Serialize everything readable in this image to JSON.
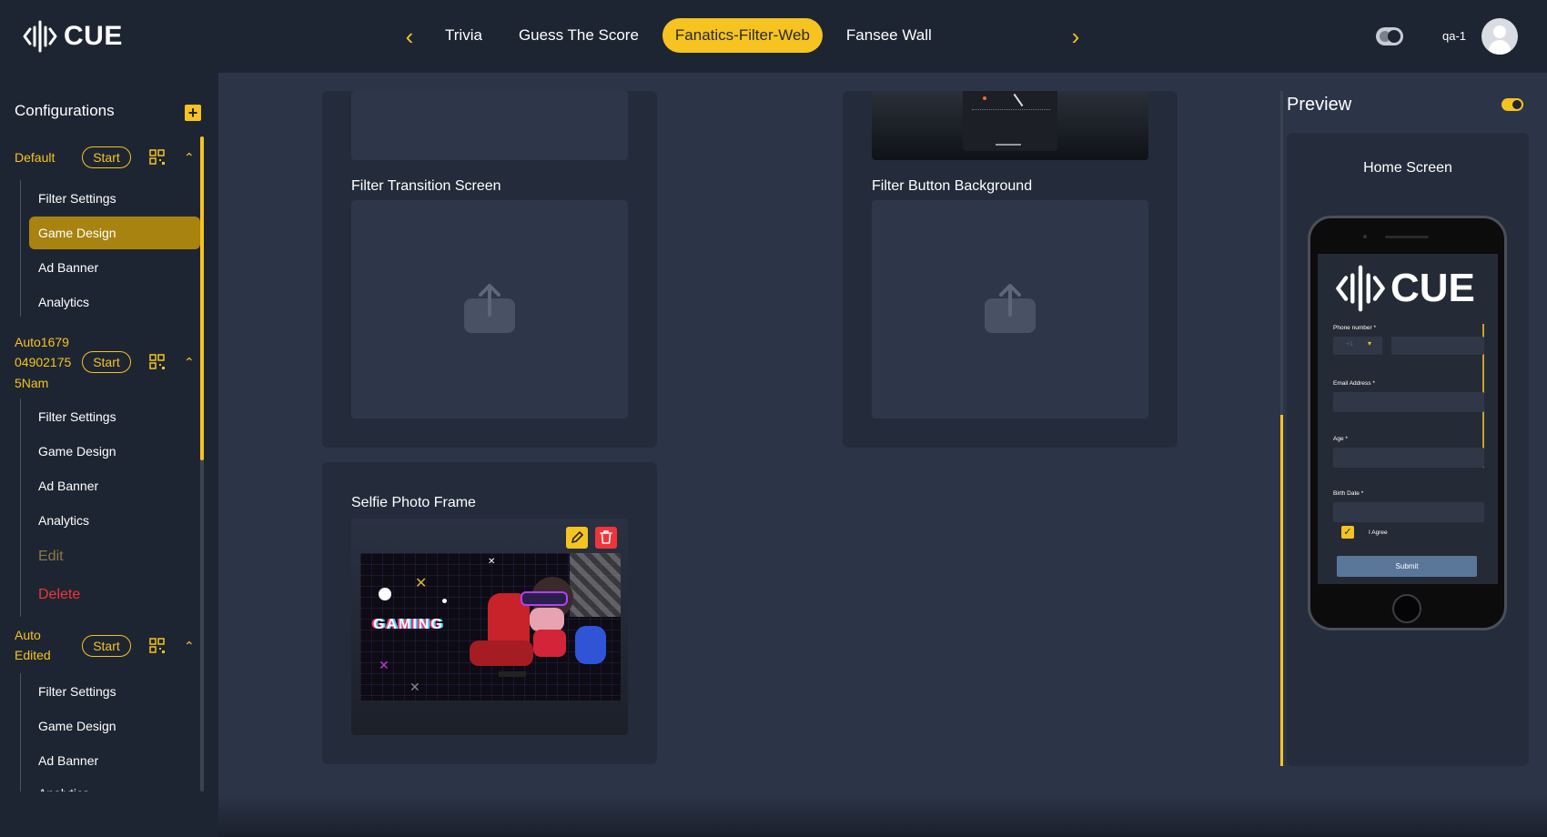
{
  "header": {
    "logo_text": "CUE",
    "tabs": [
      {
        "label": "Trivia",
        "active": false
      },
      {
        "label": "Guess The Score",
        "active": false
      },
      {
        "label": "Fanatics-Filter-Web",
        "active": true
      },
      {
        "label": "Fansee Wall",
        "active": false
      }
    ],
    "username": "qa-1"
  },
  "sidebar": {
    "title": "Configurations",
    "configs": [
      {
        "name": "Default",
        "start_label": "Start",
        "items": [
          "Filter Settings",
          "Game Design",
          "Ad Banner",
          "Analytics"
        ]
      },
      {
        "name_lines": [
          "Auto1679",
          "04902175",
          "5Nam"
        ],
        "start_label": "Start",
        "items": [
          "Filter Settings",
          "Game Design",
          "Ad Banner",
          "Analytics"
        ],
        "edit_label": "Edit",
        "delete_label": "Delete"
      },
      {
        "name_lines": [
          "Auto",
          "Edited"
        ],
        "start_label": "Start",
        "items": [
          "Filter Settings",
          "Game Design",
          "Ad Banner",
          "Analytics"
        ]
      }
    ],
    "active_item": "Game Design"
  },
  "main": {
    "filter_transition_label": "Filter Transition Screen",
    "filter_button_bg_label": "Filter Button Background",
    "selfie_frame_label": "Selfie Photo Frame",
    "gaming_text": "GAMING"
  },
  "preview": {
    "title": "Preview",
    "screen_label": "Home Screen",
    "phone": {
      "logo_text": "CUE",
      "phone_number_label": "Phone number *",
      "country_code": "+1",
      "email_label": "Email Address *",
      "age_label": "Age *",
      "birth_date_label": "Birth Date *",
      "agree_label": "I Agree",
      "submit_label": "Submit"
    }
  },
  "colors": {
    "accent": "#f6c320",
    "background": "#1e2532",
    "panel": "#2c3548",
    "danger": "#f0343a"
  }
}
